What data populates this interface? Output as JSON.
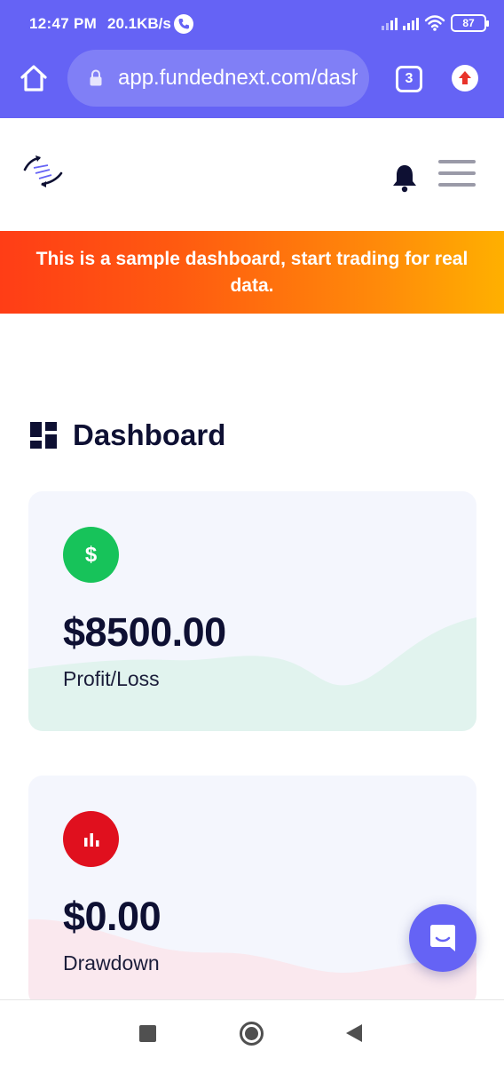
{
  "status_bar": {
    "time": "12:47 PM",
    "net_speed": "20.1KB/s",
    "battery": "87"
  },
  "browser": {
    "url": "app.fundednext.com/dashboard",
    "tab_count": "3"
  },
  "banner": {
    "text": "This is a sample dashboard, start trading for real data."
  },
  "dashboard": {
    "title": "Dashboard"
  },
  "cards": [
    {
      "icon": "dollar-icon",
      "icon_text": "$",
      "value": "$8500.00",
      "label": "Profit/Loss",
      "color": "#17c35a"
    },
    {
      "icon": "bar-chart-icon",
      "value": "$0.00",
      "label": "Drawdown",
      "color": "#e0101e"
    }
  ],
  "colors": {
    "brand": "#6563f5",
    "banner_start": "#ff3d16",
    "banner_end": "#ffb000",
    "text_dark": "#0e1033"
  }
}
